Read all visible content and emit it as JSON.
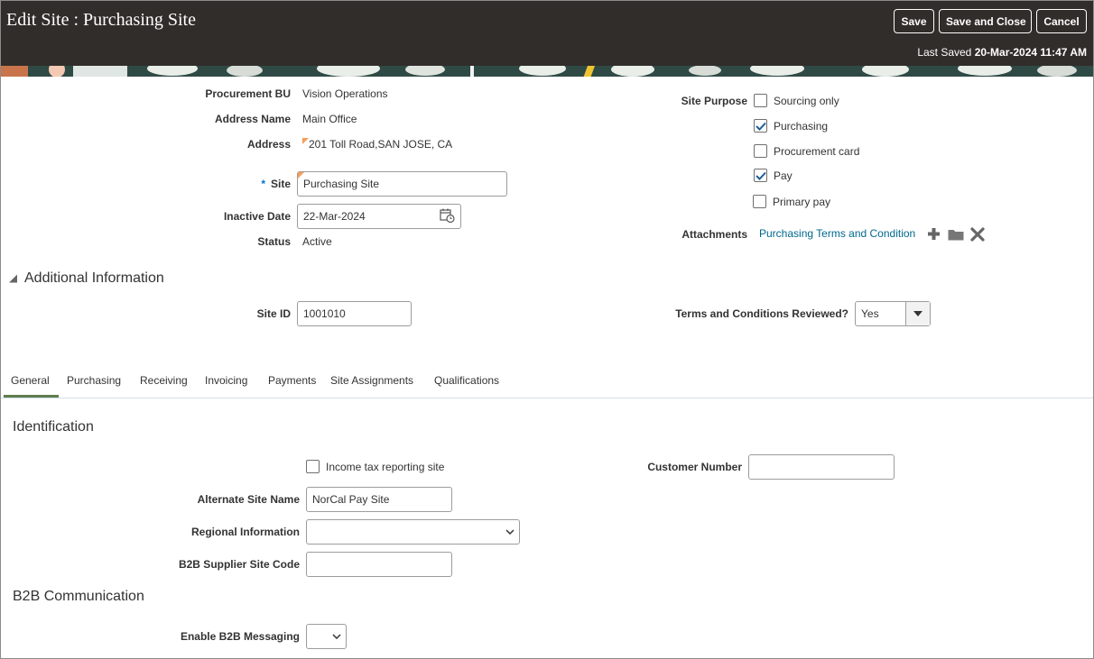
{
  "header": {
    "title": "Edit Site : Purchasing Site",
    "buttons": {
      "save": "Save",
      "save_and_close": "Save and Close",
      "cancel": "Cancel"
    },
    "last_saved_label": "Last Saved",
    "last_saved_value": "20-Mar-2024 11:47 AM"
  },
  "site": {
    "procurement_bu_label": "Procurement BU",
    "procurement_bu_value": "Vision Operations",
    "address_name_label": "Address Name",
    "address_name_value": "Main Office",
    "address_label": "Address",
    "address_value": "201 Toll Road,SAN JOSE, CA",
    "site_required": "*",
    "site_label": "Site",
    "site_value": "Purchasing Site",
    "inactive_date_label": "Inactive Date",
    "inactive_date_value": "22-Mar-2024",
    "status_label": "Status",
    "status_value": "Active"
  },
  "site_purpose": {
    "label": "Site Purpose",
    "options": [
      {
        "label": "Sourcing only",
        "checked": false
      },
      {
        "label": "Purchasing",
        "checked": true
      },
      {
        "label": "Procurement card",
        "checked": false
      },
      {
        "label": "Pay",
        "checked": true
      },
      {
        "label": "Primary pay",
        "checked": false
      }
    ]
  },
  "attachments": {
    "label": "Attachments",
    "link": "Purchasing Terms and Condition"
  },
  "additional_info": {
    "title": "Additional Information",
    "site_id_label": "Site ID",
    "site_id_value": "1001010",
    "terms_label": "Terms and Conditions Reviewed?",
    "terms_value": "Yes"
  },
  "tabs": [
    {
      "label": "General",
      "active": true
    },
    {
      "label": "Purchasing",
      "active": false
    },
    {
      "label": "Receiving",
      "active": false
    },
    {
      "label": "Invoicing",
      "active": false
    },
    {
      "label": "Payments",
      "active": false
    },
    {
      "label": "Site Assignments",
      "active": false
    },
    {
      "label": "Qualifications",
      "active": false
    }
  ],
  "identification": {
    "title": "Identification",
    "income_tax_label": "Income tax reporting site",
    "income_tax_checked": false,
    "customer_number_label": "Customer Number",
    "customer_number_value": "",
    "alternate_site_name_label": "Alternate Site Name",
    "alternate_site_name_value": "NorCal Pay Site",
    "regional_info_label": "Regional Information",
    "regional_info_value": "",
    "b2b_supplier_site_code_label": "B2B Supplier Site Code",
    "b2b_supplier_site_code_value": ""
  },
  "b2b": {
    "title": "B2B Communication",
    "enable_messaging_label": "Enable B2B Messaging",
    "enable_messaging_value": ""
  },
  "colors": {
    "header_bg": "#312d2a",
    "link": "#00688c",
    "required": "#0572ce",
    "tab_active": "#5f7d4f"
  }
}
